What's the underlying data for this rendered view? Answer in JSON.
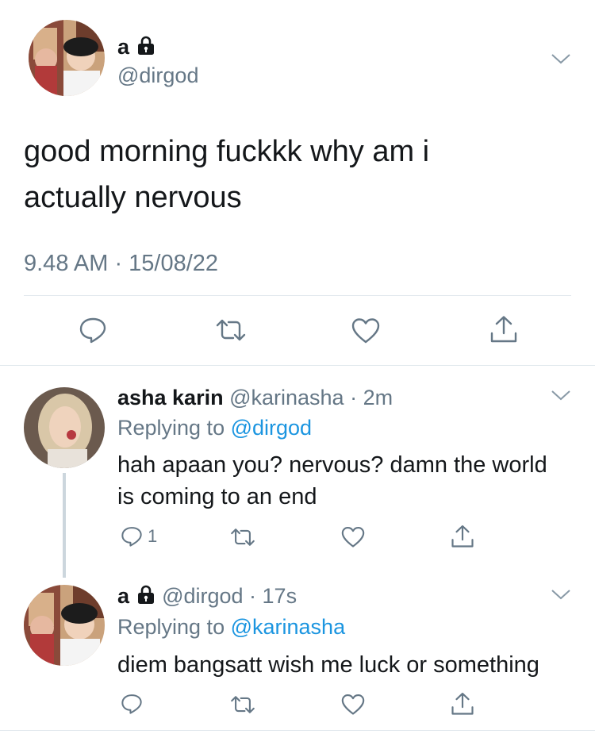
{
  "main_tweet": {
    "name": "a",
    "handle": "@dirgod",
    "text_line1": "good morning fuckkk why am i",
    "text_line2": "actually nervous",
    "timestamp": "9.48 AM · 15/08/22"
  },
  "reply1": {
    "name": "asha karin",
    "handle": "@karinasha",
    "time": "· 2m",
    "replying_label": "Replying to",
    "replying_handle": "@dirgod",
    "text_line1": "hah apaan you? nervous? damn the world",
    "text_line2": "is coming to an end",
    "reply_count": "1"
  },
  "reply2": {
    "name": "a",
    "handle": "@dirgod",
    "time": "· 17s",
    "replying_label": "Replying to",
    "replying_handle": "@karinasha",
    "text": "diem bangsatt wish me luck or something"
  },
  "colors": {
    "text": "#14171a",
    "muted": "#657786",
    "link": "#1b95e0",
    "divider": "#e1e8ed",
    "thread_line": "#ccd6dd"
  },
  "icons": [
    "lock-icon",
    "chevron-down-icon",
    "reply-icon",
    "retweet-icon",
    "like-icon",
    "share-icon"
  ]
}
